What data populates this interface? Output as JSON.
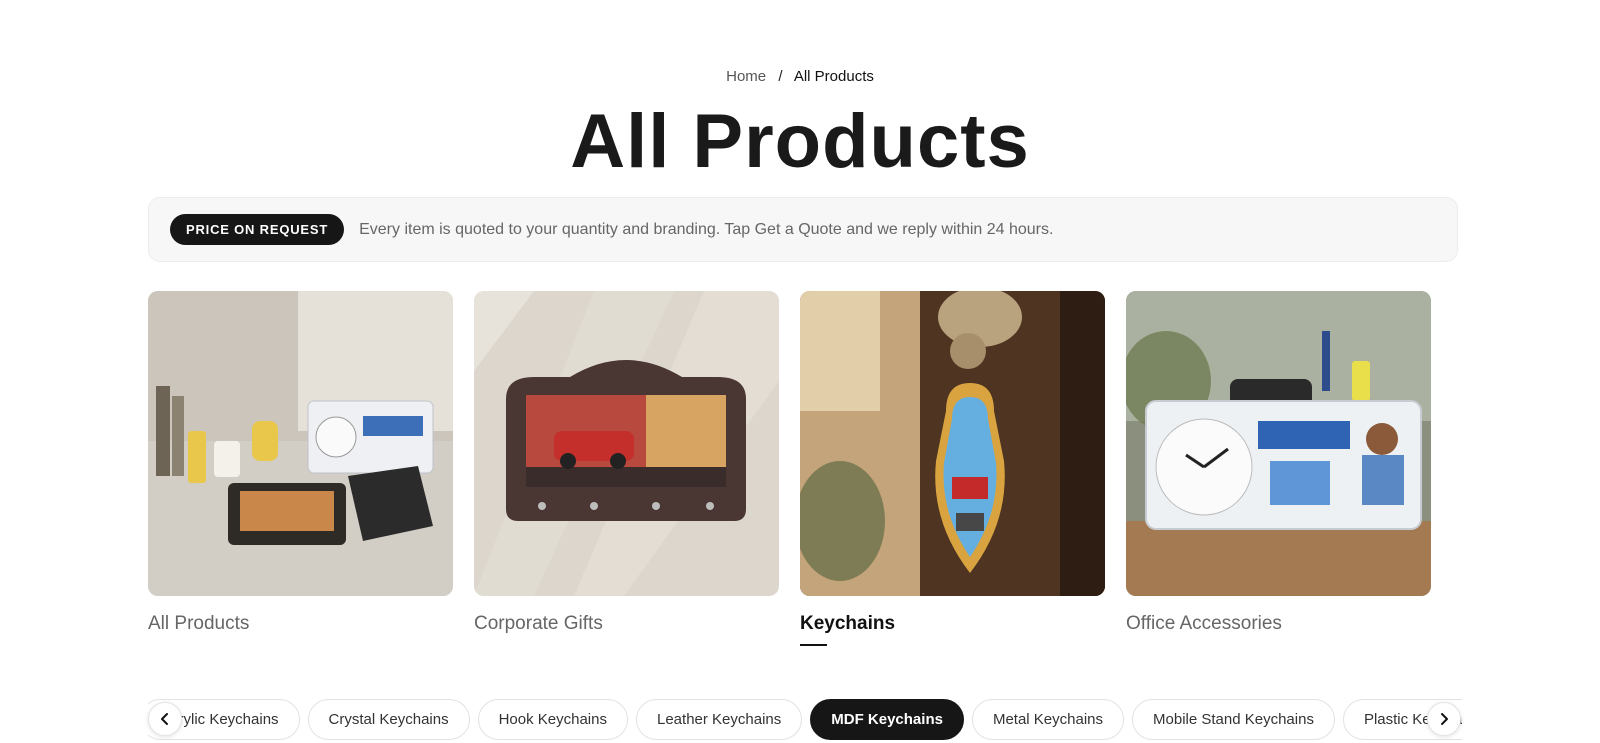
{
  "breadcrumb": {
    "home": "Home",
    "separator": "/",
    "current": "All Products"
  },
  "page_title": "All Products",
  "notice": {
    "badge": "PRICE ON REQUEST",
    "text": "Every item is quoted to your quantity and branding. Tap Get a Quote and we reply within 24 hours."
  },
  "categories": [
    {
      "label": "All Products"
    },
    {
      "label": "Corporate Gifts"
    },
    {
      "label": "Keychains",
      "active": true
    },
    {
      "label": "Office Accessories"
    }
  ],
  "subcategories": {
    "items": [
      "Acrylic Keychains",
      "Crystal Keychains",
      "Hook Keychains",
      "Leather Keychains",
      "MDF Keychains",
      "Metal Keychains",
      "Mobile Stand Keychains",
      "Plastic Keychains"
    ],
    "selected": "MDF Keychains"
  },
  "icons": {
    "prev": "chevron-left-icon",
    "next": "chevron-right-icon"
  },
  "colors": {
    "accent": "#161616",
    "muted_text": "#666666"
  }
}
